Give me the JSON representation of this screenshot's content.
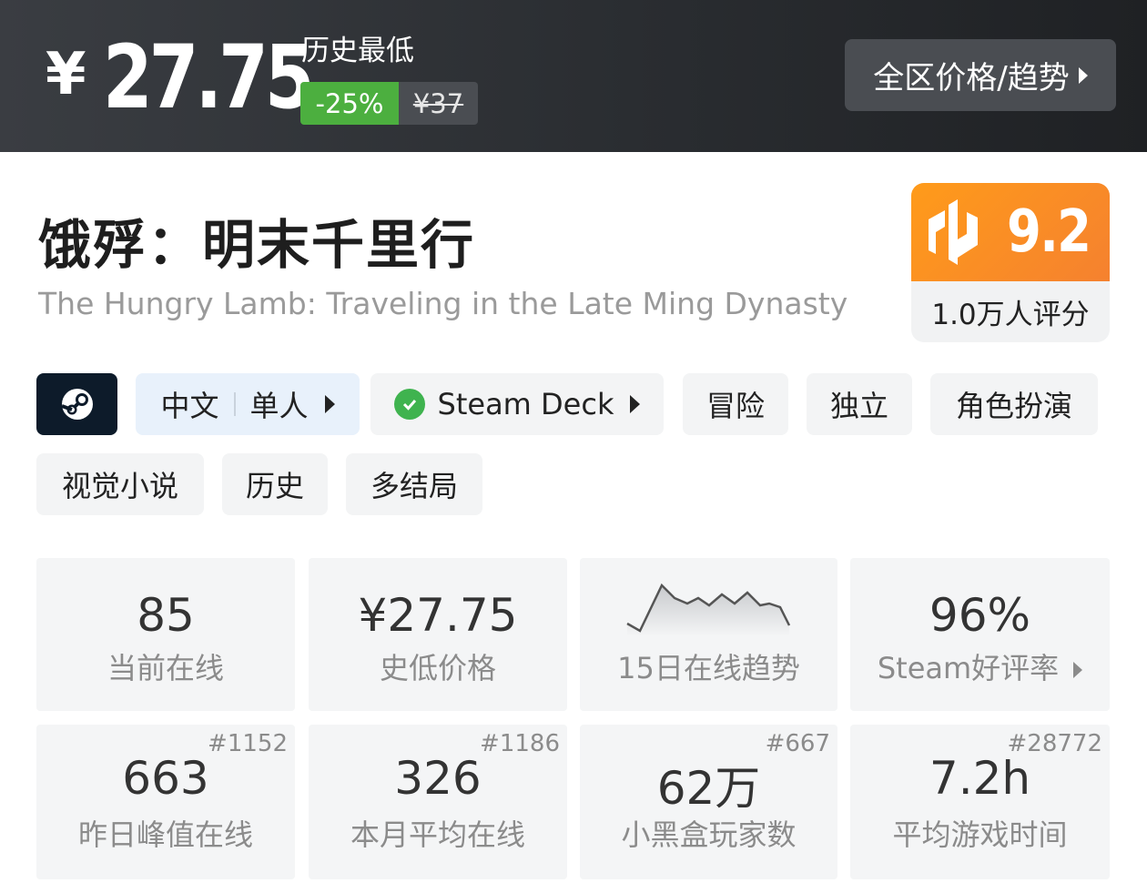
{
  "banner": {
    "currency": "¥",
    "price": "27.75",
    "history_label": "历史最低",
    "discount": "-25%",
    "original_price": "¥37",
    "region_button": "全区价格/趋势"
  },
  "game": {
    "title_cn": "饿殍：明末千里行",
    "title_en": "The Hungry Lamb: Traveling in the Late Ming Dynasty"
  },
  "score": {
    "value": "9.2",
    "count": "1.0万人评分"
  },
  "tags": {
    "language": "中文",
    "mode": "单人",
    "deck": "Steam Deck",
    "genres": [
      "冒险",
      "独立",
      "角色扮演",
      "视觉小说",
      "历史",
      "多结局"
    ]
  },
  "stats": [
    {
      "value": "85",
      "label": "当前在线"
    },
    {
      "value": "¥27.75",
      "label": "史低价格"
    },
    {
      "value": "",
      "label": "15日在线趋势"
    },
    {
      "value": "96%",
      "label": "Steam好评率"
    },
    {
      "value": "663",
      "label": "昨日峰值在线",
      "rank": "#1152"
    },
    {
      "value": "326",
      "label": "本月平均在线",
      "rank": "#1186"
    },
    {
      "value": "62万",
      "label": "小黑盒玩家数",
      "rank": "#667"
    },
    {
      "value": "7.2h",
      "label": "平均游戏时间",
      "rank": "#28772"
    }
  ],
  "colors": {
    "discount_green": "#4caf3f",
    "score_orange": "#f5812f",
    "steam_dark": "#0d1b2a",
    "deck_check": "#3fb34f"
  }
}
